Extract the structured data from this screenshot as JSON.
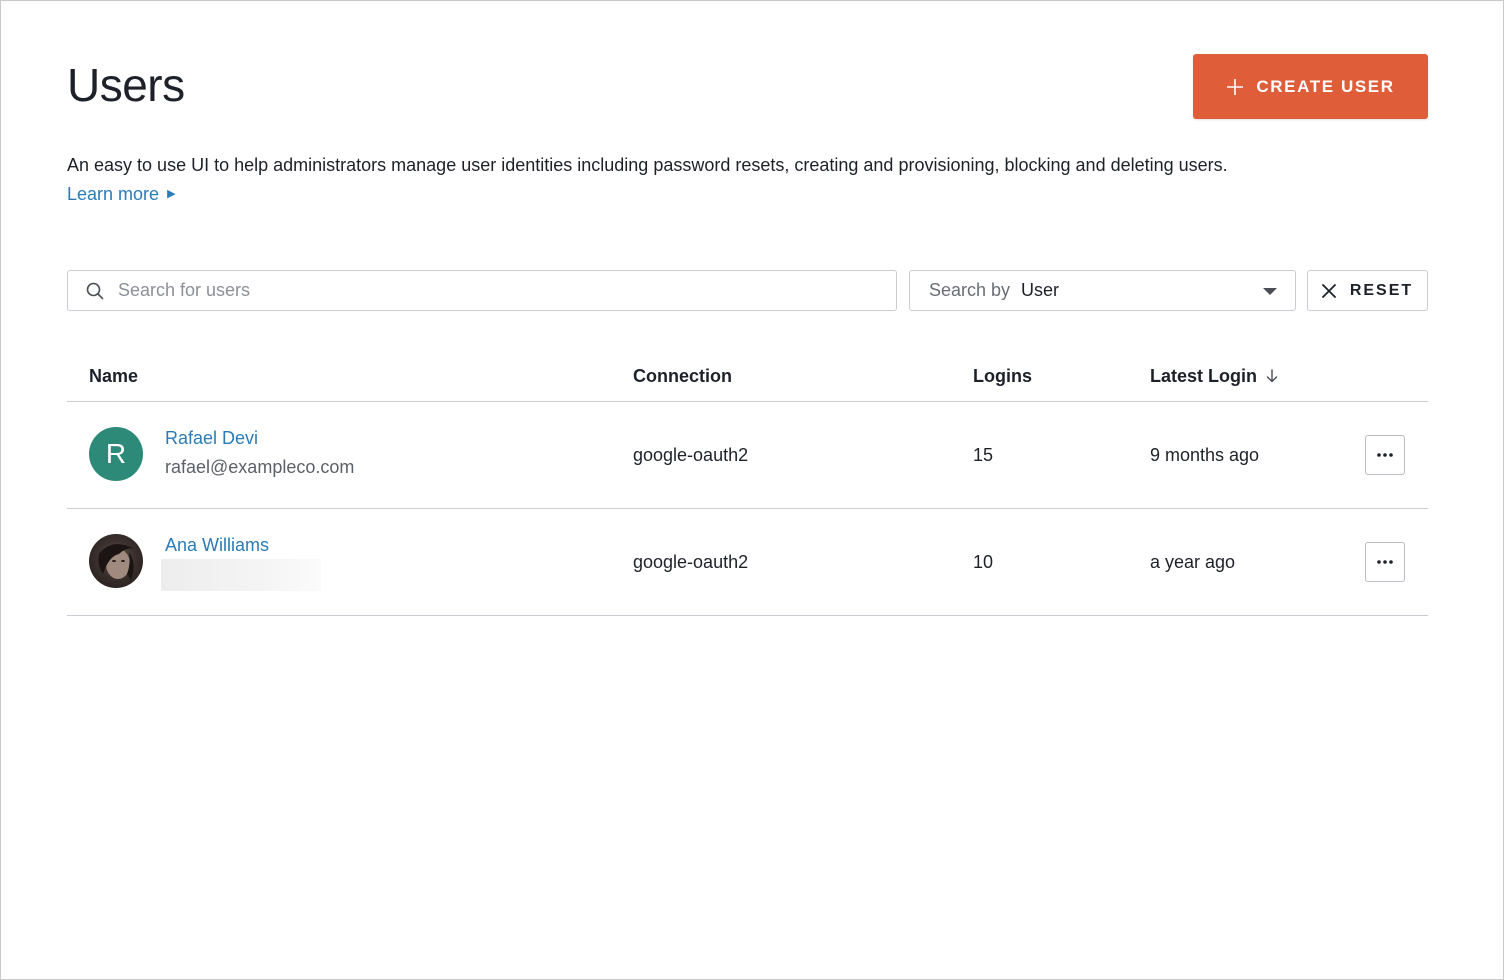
{
  "page": {
    "title": "Users",
    "description": "An easy to use UI to help administrators manage user identities including password resets, creating and provisioning, blocking and deleting users.",
    "learn_more": "Learn more"
  },
  "toolbar": {
    "create_label": "CREATE USER",
    "create_icon": "plus-icon",
    "accent_color": "#e05d3a"
  },
  "search": {
    "placeholder": "Search for users",
    "value": "",
    "search_by_label": "Search by",
    "search_by_value": "User",
    "reset_label": "RESET"
  },
  "table": {
    "columns": {
      "name": "Name",
      "connection": "Connection",
      "logins": "Logins",
      "latest_login": "Latest Login"
    },
    "sort": {
      "column": "latest_login",
      "direction": "descending"
    },
    "rows": [
      {
        "avatar_initial": "R",
        "avatar_color": "#2e8a78",
        "name": "Rafael Devi",
        "email": "rafael@exampleco.com",
        "connection": "google-oauth2",
        "logins": "15",
        "latest_login": "9 months ago"
      },
      {
        "avatar_type": "photo",
        "name": "Ana Williams",
        "email_redacted": true,
        "connection": "google-oauth2",
        "logins": "10",
        "latest_login": "a year ago"
      }
    ]
  },
  "colors": {
    "link": "#2b7bb5",
    "text": "#1e212a",
    "border": "#c9ccd1"
  }
}
